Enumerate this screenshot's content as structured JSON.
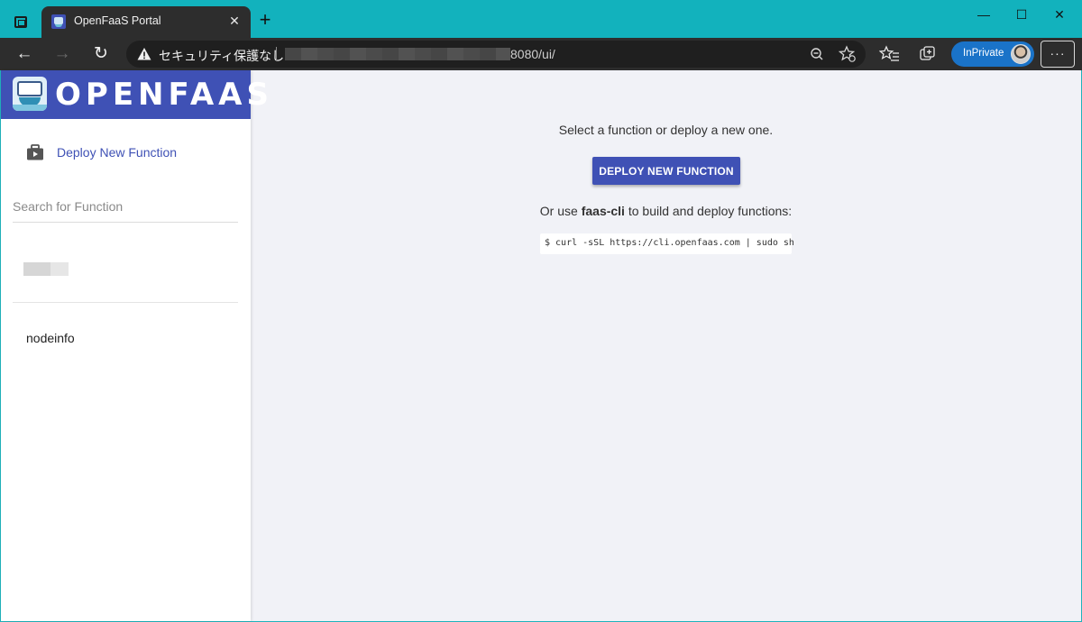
{
  "browser": {
    "tab_title": "OpenFaaS Portal",
    "tab_close": "✕",
    "new_tab": "+",
    "window_controls": {
      "minimize": "—",
      "maximize": "☐",
      "close": "✕"
    },
    "nav": {
      "back": "←",
      "forward": "→",
      "refresh": "↻"
    },
    "security_label": "セキュリティ保護なし",
    "url_visible": "8080/ui/",
    "inprivate_label": "InPrivate",
    "more_label": "···",
    "icons": [
      "tab-actions-icon",
      "warning-icon",
      "zoom-out-icon",
      "favorite-add-icon",
      "favorites-icon",
      "collections-icon",
      "profile-avatar-icon"
    ]
  },
  "sidebar": {
    "brand_name": "OPENFAAS",
    "deploy_link_label": "Deploy New Function",
    "search": {
      "placeholder": "Search for Function",
      "value": ""
    },
    "functions": [
      {
        "name": "",
        "redacted": true
      },
      {
        "name": "nodeinfo"
      }
    ]
  },
  "main": {
    "prompt": "Select a function or deploy a new one.",
    "deploy_button_label": "DEPLOY NEW FUNCTION",
    "cli_prefix": "Or use ",
    "cli_name": "faas-cli",
    "cli_suffix": " to build and deploy functions:",
    "cli_command": "$ curl -sSL https://cli.openfaas.com | sudo sh"
  },
  "colors": {
    "accent": "#3f51b5",
    "frame": "#12b2bd",
    "toolbar": "#2d2d2d",
    "page_background": "#f1f2f7",
    "inprivate": "#1a73c8"
  }
}
